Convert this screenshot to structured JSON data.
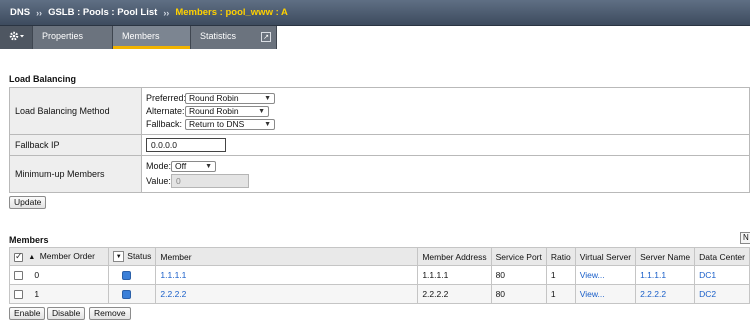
{
  "breadcrumb": {
    "items": [
      "DNS",
      "GSLB : Pools : Pool List"
    ],
    "current": "Members : pool_www : A",
    "separator": "››"
  },
  "tabs": {
    "gear_icon": "gear-icon",
    "items": [
      {
        "label": "Properties",
        "active": false
      },
      {
        "label": "Members",
        "active": true
      },
      {
        "label": "Statistics",
        "active": false
      }
    ],
    "accent": "#f2b400"
  },
  "load_balancing": {
    "title": "Load Balancing",
    "method": {
      "label": "Load Balancing Method",
      "preferred": {
        "label": "Preferred:",
        "value": "Round Robin"
      },
      "alternate": {
        "label": "Alternate:",
        "value": "Round Robin"
      },
      "fallback": {
        "label": "Fallback:",
        "value": "Return to DNS"
      }
    },
    "fallback_ip": {
      "label": "Fallback IP",
      "value": "0.0.0.0"
    },
    "minimum_up": {
      "label": "Minimum-up Members",
      "mode": {
        "label": "Mode:",
        "value": "Off"
      },
      "value": {
        "label": "Value:",
        "value": "0"
      }
    },
    "update_label": "Update"
  },
  "members": {
    "title": "Members",
    "stub_label": "N",
    "columns": {
      "order": "Member Order",
      "status": "Status",
      "member": "Member",
      "address": "Member Address",
      "port": "Service Port",
      "ratio": "Ratio",
      "virtual_server": "Virtual Server",
      "server_name": "Server Name",
      "data_center": "Data Center"
    },
    "rows": [
      {
        "order": "0",
        "status_color": "#3a7fd8",
        "member": "1.1.1.1",
        "address": "1.1.1.1",
        "port": "80",
        "ratio": "1",
        "virtual_server": "View...",
        "server_name": "1.1.1.1",
        "data_center": "DC1"
      },
      {
        "order": "1",
        "status_color": "#3a7fd8",
        "member": "2.2.2.2",
        "address": "2.2.2.2",
        "port": "80",
        "ratio": "1",
        "virtual_server": "View...",
        "server_name": "2.2.2.2",
        "data_center": "DC2"
      }
    ],
    "buttons": {
      "enable": "Enable",
      "disable": "Disable",
      "remove": "Remove"
    }
  }
}
